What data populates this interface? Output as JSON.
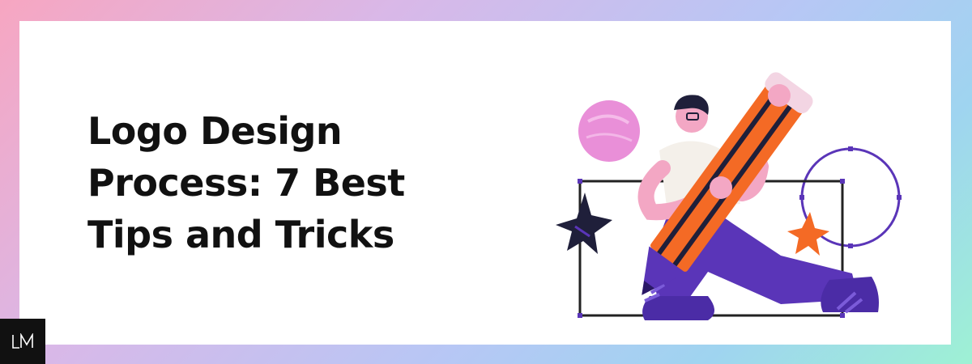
{
  "headline": {
    "line1": "Logo Design",
    "line2": "Process: 7 Best",
    "line3": "Tips and Tricks"
  },
  "brand": {
    "logo_text": "LM"
  },
  "colors": {
    "gradient_start": "#f7a6c1",
    "gradient_end": "#9ef1d4",
    "card_background": "#ffffff",
    "headline": "#111111",
    "accent_orange": "#f46a25",
    "accent_purple": "#5a35b8",
    "accent_pink": "#e98fd8"
  },
  "illustration": {
    "subject": "person holding giant pencil",
    "icons": [
      "pencil-icon",
      "star-icon",
      "circle-icon"
    ]
  }
}
